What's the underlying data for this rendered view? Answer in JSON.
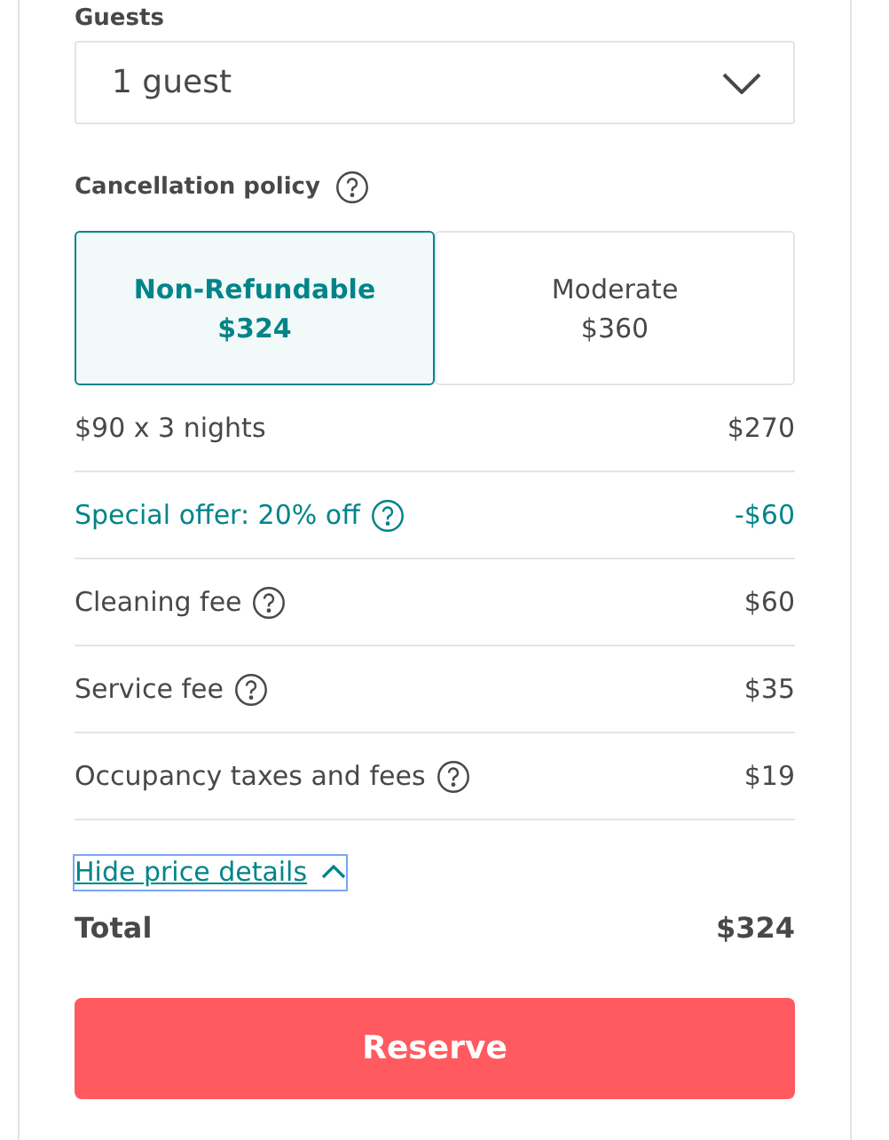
{
  "guests": {
    "label": "Guests",
    "value": "1 guest"
  },
  "cancellation": {
    "label": "Cancellation policy",
    "options": [
      {
        "name": "Non-Refundable",
        "price": "$324",
        "selected": true
      },
      {
        "name": "Moderate",
        "price": "$360",
        "selected": false
      }
    ]
  },
  "line_items": [
    {
      "kind": "charge",
      "label": "$90 x 3 nights",
      "amount": "$270",
      "help": false
    },
    {
      "kind": "discount",
      "label": "Special offer: 20% off",
      "amount": "-$60",
      "help": true
    },
    {
      "kind": "charge",
      "label": "Cleaning fee",
      "amount": "$60",
      "help": true
    },
    {
      "kind": "charge",
      "label": "Service fee",
      "amount": "$35",
      "help": true
    },
    {
      "kind": "charge",
      "label": "Occupancy taxes and fees",
      "amount": "$19",
      "help": true
    }
  ],
  "details_toggle": {
    "label": "Hide price details",
    "expanded": true,
    "focused": true
  },
  "total": {
    "label": "Total",
    "amount": "$324"
  },
  "reserve_button": "Reserve"
}
